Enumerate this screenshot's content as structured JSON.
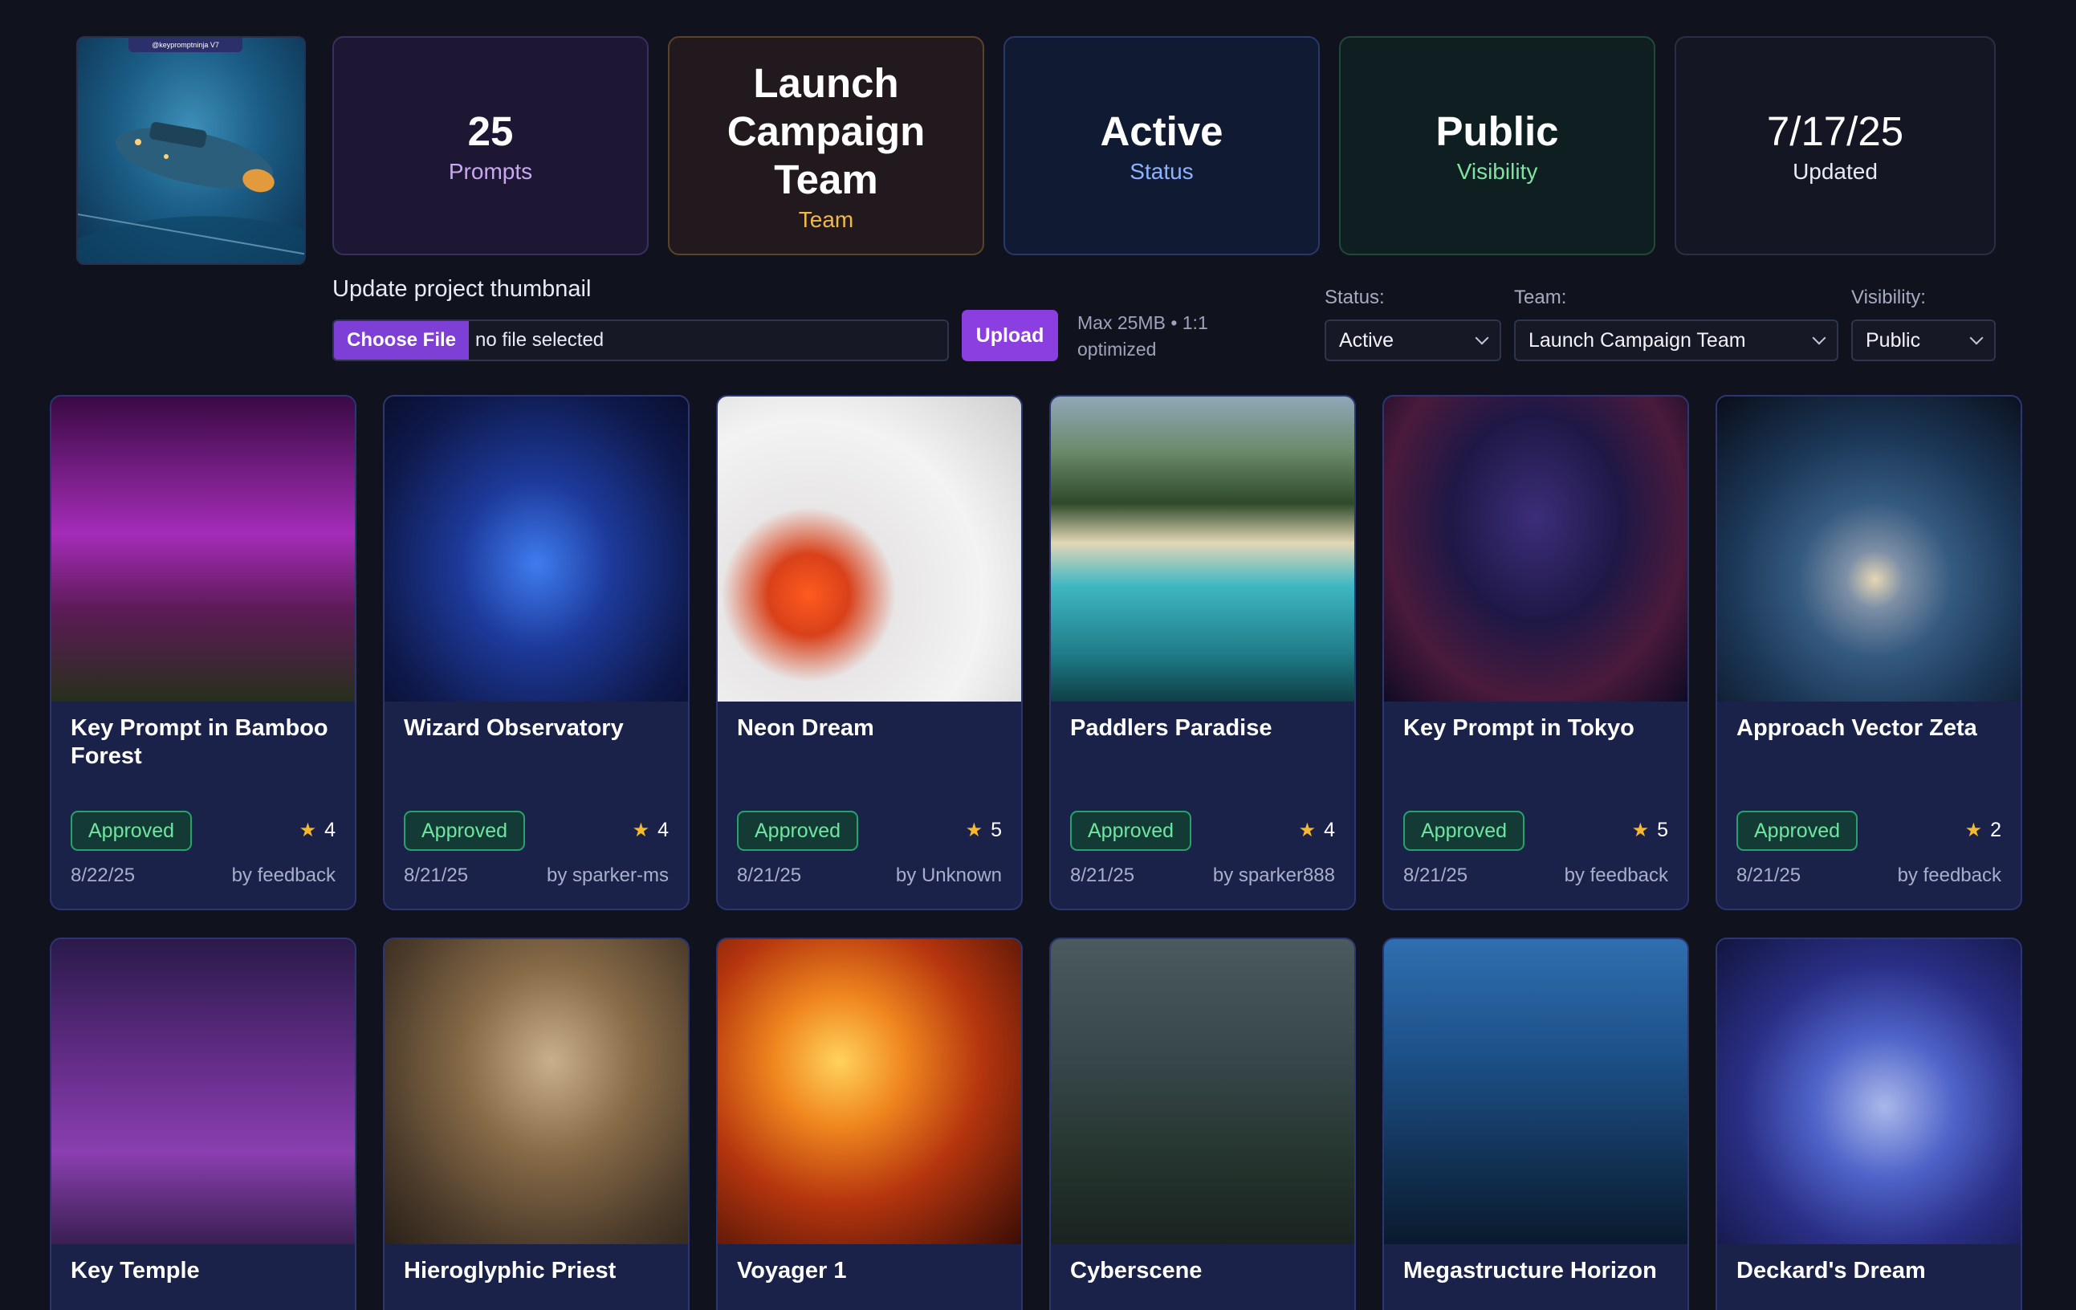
{
  "thumbnail": {
    "badge": "@keypromptninja V7"
  },
  "stats": [
    {
      "value": "25",
      "label": "Prompts"
    },
    {
      "value": "Launch Campaign Team",
      "label": "Team"
    },
    {
      "value": "Active",
      "label": "Status"
    },
    {
      "value": "Public",
      "label": "Visibility"
    },
    {
      "value": "7/17/25",
      "label": "Updated"
    }
  ],
  "upload": {
    "title": "Update project thumbnail",
    "choose_label": "Choose File",
    "file_name": "no file selected",
    "upload_label": "Upload",
    "max_info": "Max 25MB • 1:1 optimized"
  },
  "filters": {
    "status": {
      "label": "Status:",
      "value": "Active"
    },
    "team": {
      "label": "Team:",
      "value": "Launch Campaign Team"
    },
    "visibility": {
      "label": "Visibility:",
      "value": "Public"
    }
  },
  "cards": [
    {
      "title": "Key Prompt in Bamboo Forest",
      "status": "Approved",
      "rating": "4",
      "date": "8/22/25",
      "author": "by feedback"
    },
    {
      "title": "Wizard Observatory",
      "status": "Approved",
      "rating": "4",
      "date": "8/21/25",
      "author": "by sparker-ms"
    },
    {
      "title": "Neon Dream",
      "status": "Approved",
      "rating": "5",
      "date": "8/21/25",
      "author": "by Unknown"
    },
    {
      "title": "Paddlers Paradise",
      "status": "Approved",
      "rating": "4",
      "date": "8/21/25",
      "author": "by sparker888"
    },
    {
      "title": "Key Prompt in Tokyo",
      "status": "Approved",
      "rating": "5",
      "date": "8/21/25",
      "author": "by feedback"
    },
    {
      "title": "Approach Vector Zeta",
      "status": "Approved",
      "rating": "2",
      "date": "8/21/25",
      "author": "by feedback"
    },
    {
      "title": "Key Temple"
    },
    {
      "title": "Hieroglyphic Priest"
    },
    {
      "title": "Voyager 1"
    },
    {
      "title": "Cyberscene"
    },
    {
      "title": "Megastructure Horizon"
    },
    {
      "title": "Deckard's Dream"
    }
  ],
  "colors": {
    "background": "#10121d",
    "card": "#1b2249",
    "accent_purple": "#8b3fe0",
    "approved_green": "#6ee6a0",
    "star": "#f5b82e"
  }
}
